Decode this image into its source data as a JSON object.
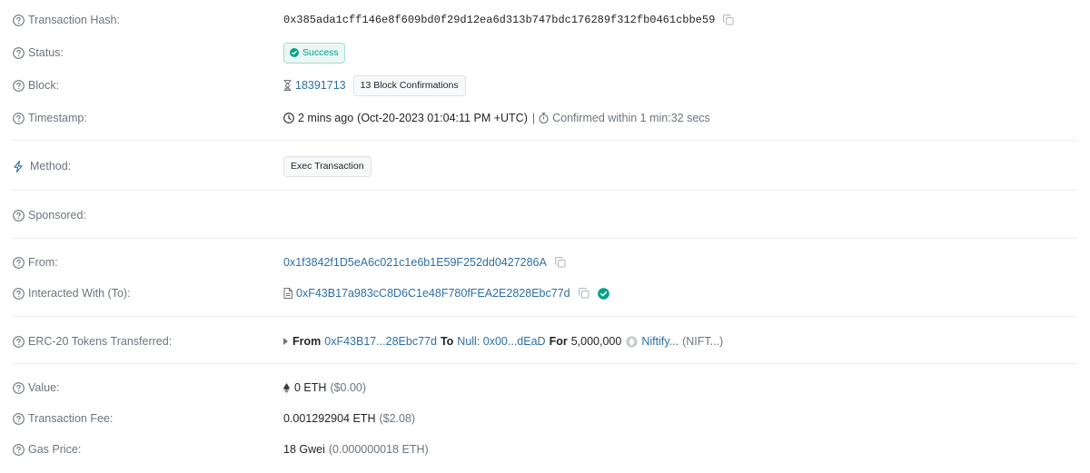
{
  "transaction_hash": {
    "label": "Transaction Hash:",
    "value": "0x385ada1cff146e8f609bd0f29d12ea6d313b747bdc176289f312fb0461cbbe59"
  },
  "status": {
    "label": "Status:",
    "value": "Success"
  },
  "block": {
    "label": "Block:",
    "number": "18391713",
    "confirmations": "13 Block Confirmations"
  },
  "timestamp": {
    "label": "Timestamp:",
    "ago": "2 mins ago",
    "datetime": "(Oct-20-2023 01:04:11 PM +UTC)",
    "divider": "|",
    "confirmed": "Confirmed within 1 min:32 secs"
  },
  "method": {
    "label": "Method:",
    "value": "Exec Transaction"
  },
  "sponsored": {
    "label": "Sponsored:"
  },
  "from": {
    "label": "From:",
    "address": "0x1f3842f1D5eA6c021c1e6b1E59F252dd0427286A"
  },
  "interacted_with": {
    "label": "Interacted With (To):",
    "address": "0xF43B17a983cC8D6C1e48F780fFEA2E2828Ebc77d"
  },
  "erc20": {
    "label": "ERC-20 Tokens Transferred:",
    "from_word": "From",
    "from_addr": "0xF43B17...28Ebc77d",
    "to_word": "To",
    "to_addr": "Null: 0x00...dEaD",
    "for_word": "For",
    "amount": "5,000,000",
    "token_name": "Niftify...",
    "token_symbol": "(NIFT...)"
  },
  "value": {
    "label": "Value:",
    "amount": "0 ETH",
    "usd": "($0.00)"
  },
  "fee": {
    "label": "Transaction Fee:",
    "amount": "0.001292904 ETH",
    "usd": "($2.08)"
  },
  "gas_price": {
    "label": "Gas Price:",
    "amount": "18 Gwei",
    "eth": "(0.000000018 ETH)"
  },
  "colors": {
    "link": "#2d6fa5",
    "success": "#00a186",
    "label": "#6c757d",
    "separator": "#e9ecef"
  }
}
